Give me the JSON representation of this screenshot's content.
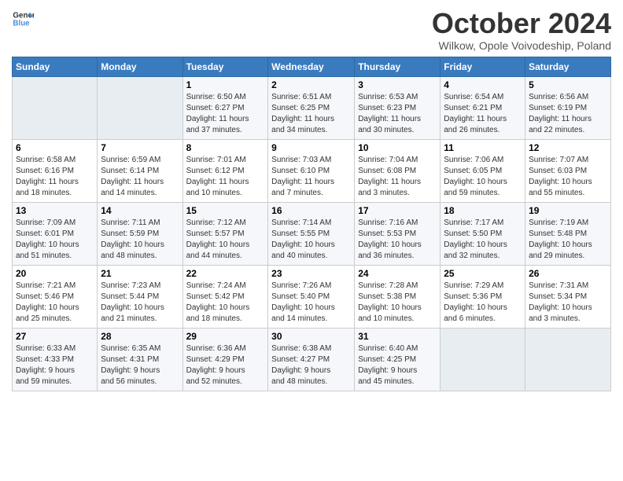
{
  "header": {
    "logo_line1": "General",
    "logo_line2": "Blue",
    "month_title": "October 2024",
    "subtitle": "Wilkow, Opole Voivodeship, Poland"
  },
  "weekdays": [
    "Sunday",
    "Monday",
    "Tuesday",
    "Wednesday",
    "Thursday",
    "Friday",
    "Saturday"
  ],
  "weeks": [
    [
      {
        "day": "",
        "info": ""
      },
      {
        "day": "",
        "info": ""
      },
      {
        "day": "1",
        "info": "Sunrise: 6:50 AM\nSunset: 6:27 PM\nDaylight: 11 hours\nand 37 minutes."
      },
      {
        "day": "2",
        "info": "Sunrise: 6:51 AM\nSunset: 6:25 PM\nDaylight: 11 hours\nand 34 minutes."
      },
      {
        "day": "3",
        "info": "Sunrise: 6:53 AM\nSunset: 6:23 PM\nDaylight: 11 hours\nand 30 minutes."
      },
      {
        "day": "4",
        "info": "Sunrise: 6:54 AM\nSunset: 6:21 PM\nDaylight: 11 hours\nand 26 minutes."
      },
      {
        "day": "5",
        "info": "Sunrise: 6:56 AM\nSunset: 6:19 PM\nDaylight: 11 hours\nand 22 minutes."
      }
    ],
    [
      {
        "day": "6",
        "info": "Sunrise: 6:58 AM\nSunset: 6:16 PM\nDaylight: 11 hours\nand 18 minutes."
      },
      {
        "day": "7",
        "info": "Sunrise: 6:59 AM\nSunset: 6:14 PM\nDaylight: 11 hours\nand 14 minutes."
      },
      {
        "day": "8",
        "info": "Sunrise: 7:01 AM\nSunset: 6:12 PM\nDaylight: 11 hours\nand 10 minutes."
      },
      {
        "day": "9",
        "info": "Sunrise: 7:03 AM\nSunset: 6:10 PM\nDaylight: 11 hours\nand 7 minutes."
      },
      {
        "day": "10",
        "info": "Sunrise: 7:04 AM\nSunset: 6:08 PM\nDaylight: 11 hours\nand 3 minutes."
      },
      {
        "day": "11",
        "info": "Sunrise: 7:06 AM\nSunset: 6:05 PM\nDaylight: 10 hours\nand 59 minutes."
      },
      {
        "day": "12",
        "info": "Sunrise: 7:07 AM\nSunset: 6:03 PM\nDaylight: 10 hours\nand 55 minutes."
      }
    ],
    [
      {
        "day": "13",
        "info": "Sunrise: 7:09 AM\nSunset: 6:01 PM\nDaylight: 10 hours\nand 51 minutes."
      },
      {
        "day": "14",
        "info": "Sunrise: 7:11 AM\nSunset: 5:59 PM\nDaylight: 10 hours\nand 48 minutes."
      },
      {
        "day": "15",
        "info": "Sunrise: 7:12 AM\nSunset: 5:57 PM\nDaylight: 10 hours\nand 44 minutes."
      },
      {
        "day": "16",
        "info": "Sunrise: 7:14 AM\nSunset: 5:55 PM\nDaylight: 10 hours\nand 40 minutes."
      },
      {
        "day": "17",
        "info": "Sunrise: 7:16 AM\nSunset: 5:53 PM\nDaylight: 10 hours\nand 36 minutes."
      },
      {
        "day": "18",
        "info": "Sunrise: 7:17 AM\nSunset: 5:50 PM\nDaylight: 10 hours\nand 32 minutes."
      },
      {
        "day": "19",
        "info": "Sunrise: 7:19 AM\nSunset: 5:48 PM\nDaylight: 10 hours\nand 29 minutes."
      }
    ],
    [
      {
        "day": "20",
        "info": "Sunrise: 7:21 AM\nSunset: 5:46 PM\nDaylight: 10 hours\nand 25 minutes."
      },
      {
        "day": "21",
        "info": "Sunrise: 7:23 AM\nSunset: 5:44 PM\nDaylight: 10 hours\nand 21 minutes."
      },
      {
        "day": "22",
        "info": "Sunrise: 7:24 AM\nSunset: 5:42 PM\nDaylight: 10 hours\nand 18 minutes."
      },
      {
        "day": "23",
        "info": "Sunrise: 7:26 AM\nSunset: 5:40 PM\nDaylight: 10 hours\nand 14 minutes."
      },
      {
        "day": "24",
        "info": "Sunrise: 7:28 AM\nSunset: 5:38 PM\nDaylight: 10 hours\nand 10 minutes."
      },
      {
        "day": "25",
        "info": "Sunrise: 7:29 AM\nSunset: 5:36 PM\nDaylight: 10 hours\nand 6 minutes."
      },
      {
        "day": "26",
        "info": "Sunrise: 7:31 AM\nSunset: 5:34 PM\nDaylight: 10 hours\nand 3 minutes."
      }
    ],
    [
      {
        "day": "27",
        "info": "Sunrise: 6:33 AM\nSunset: 4:33 PM\nDaylight: 9 hours\nand 59 minutes."
      },
      {
        "day": "28",
        "info": "Sunrise: 6:35 AM\nSunset: 4:31 PM\nDaylight: 9 hours\nand 56 minutes."
      },
      {
        "day": "29",
        "info": "Sunrise: 6:36 AM\nSunset: 4:29 PM\nDaylight: 9 hours\nand 52 minutes."
      },
      {
        "day": "30",
        "info": "Sunrise: 6:38 AM\nSunset: 4:27 PM\nDaylight: 9 hours\nand 48 minutes."
      },
      {
        "day": "31",
        "info": "Sunrise: 6:40 AM\nSunset: 4:25 PM\nDaylight: 9 hours\nand 45 minutes."
      },
      {
        "day": "",
        "info": ""
      },
      {
        "day": "",
        "info": ""
      }
    ]
  ]
}
